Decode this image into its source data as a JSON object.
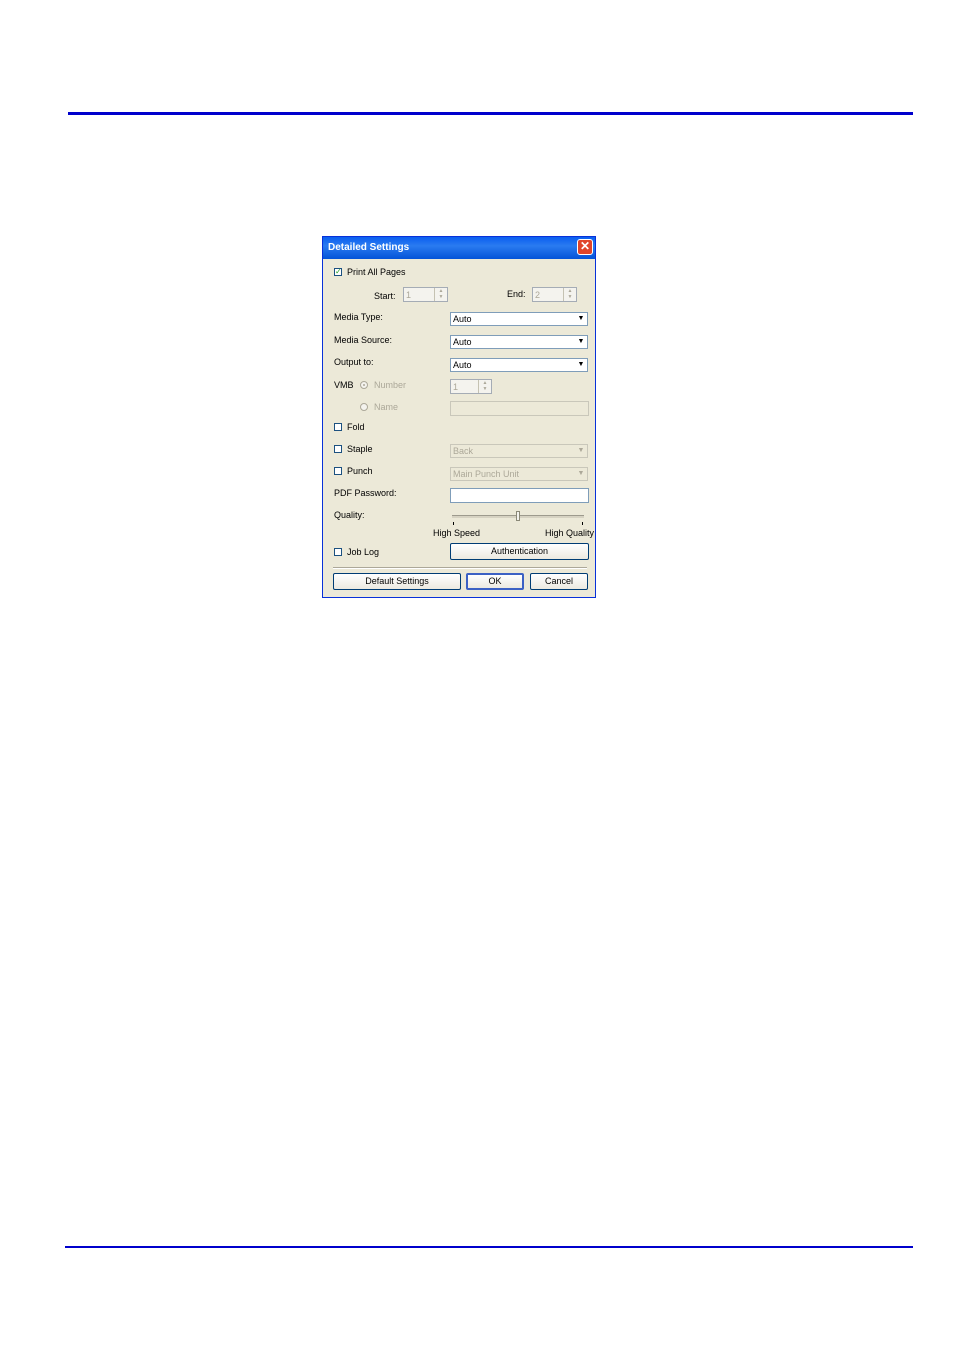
{
  "dialog": {
    "title": "Detailed Settings",
    "close_glyph": "✕",
    "print_all_pages": {
      "label": "Print All Pages",
      "checked": true
    },
    "start": {
      "label": "Start:",
      "value": "1"
    },
    "end": {
      "label": "End:",
      "value": "2"
    },
    "media_type": {
      "label": "Media Type:",
      "value": "Auto"
    },
    "media_source": {
      "label": "Media Source:",
      "value": "Auto"
    },
    "output_to": {
      "label": "Output to:",
      "value": "Auto"
    },
    "vmb": {
      "label": "VMB",
      "number_label": "Number",
      "name_label": "Name",
      "number_value": "1",
      "selected": "Number"
    },
    "fold": {
      "label": "Fold",
      "checked": false
    },
    "staple": {
      "label": "Staple",
      "checked": false,
      "value": "Back"
    },
    "punch": {
      "label": "Punch",
      "checked": false,
      "value": "Main Punch Unit"
    },
    "pdf_password": {
      "label": "PDF Password:",
      "value": ""
    },
    "quality": {
      "label": "Quality:",
      "min_label": "High Speed",
      "max_label": "High Quality",
      "level": 0.5
    },
    "job_log": {
      "label": "Job Log",
      "checked": false
    },
    "authentication_label": "Authentication",
    "default_settings_label": "Default Settings",
    "ok_label": "OK",
    "cancel_label": "Cancel",
    "checkmark_glyph": "✓",
    "arrow_glyph": "▼",
    "spin_up": "▲",
    "spin_down": "▼"
  }
}
